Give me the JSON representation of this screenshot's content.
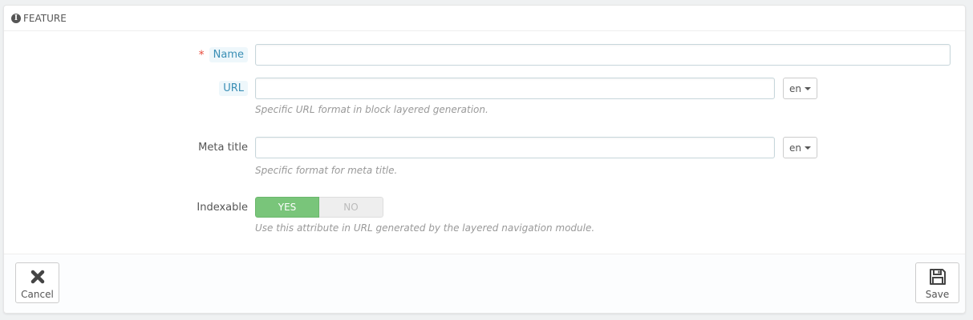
{
  "panel": {
    "heading": "Feature",
    "icon": "info-icon"
  },
  "form": {
    "name": {
      "label": "Name",
      "required_mark": "*",
      "value": ""
    },
    "url": {
      "label": "URL",
      "value": "",
      "lang": "en",
      "help": "Specific URL format in block layered generation."
    },
    "meta_title": {
      "label": "Meta title",
      "value": "",
      "lang": "en",
      "help": "Specific format for meta title."
    },
    "indexable": {
      "label": "Indexable",
      "yes_label": "YES",
      "no_label": "NO",
      "selected": "YES",
      "help": "Use this attribute in URL generated by the layered navigation module."
    }
  },
  "footer": {
    "cancel_label": "Cancel",
    "save_label": "Save"
  },
  "colors": {
    "switch_on": "#79c57a",
    "required": "#e84c3d",
    "hint_text": "#3a8fb5"
  }
}
